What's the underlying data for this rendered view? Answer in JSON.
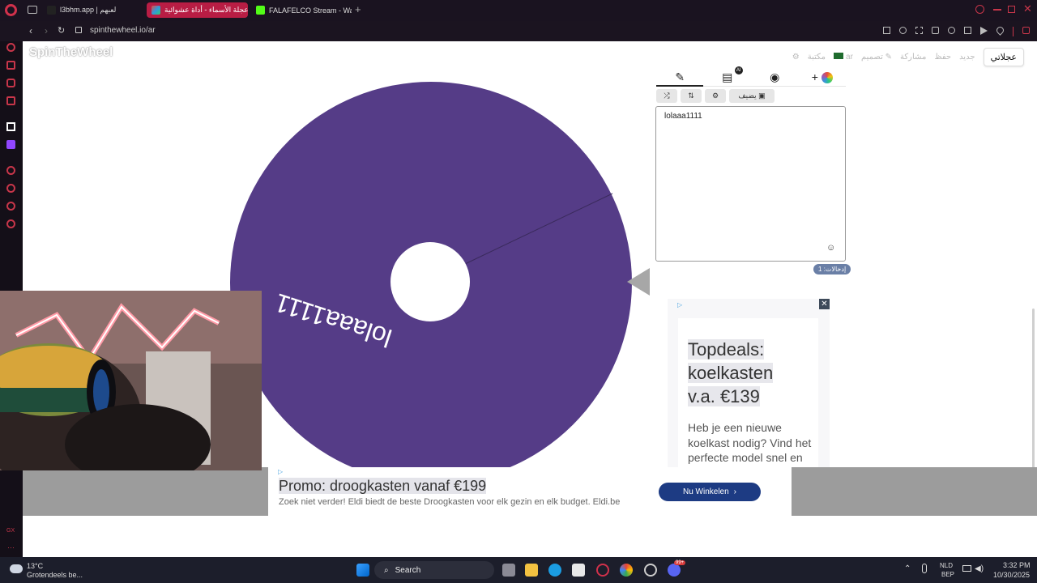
{
  "tabs": [
    {
      "label": "l3bhm.app | لعبهم",
      "active": false
    },
    {
      "label": "برنامج عجلة الأسماء - أداة عشوائية",
      "active": true
    },
    {
      "label": "FALAFELCO Stream - Watch",
      "active": false
    }
  ],
  "address": {
    "url": "spinthewheel.io/ar"
  },
  "site": {
    "logo": "SpinTheWheel"
  },
  "nav": {
    "mine": "عجلاتي",
    "gallery": "مكتبة",
    "lang": "ar",
    "design": "تصميم",
    "share": "مشاركة",
    "save": "حفظ",
    "new": "جديد"
  },
  "editor": {
    "add_label": "يضيف",
    "entries_text": "lolaaa1111",
    "entry_count": "إدخالات: 1",
    "ai_badge": "AI"
  },
  "wheel": {
    "segment_label": "lolaaa1111",
    "segment_color": "#553c87",
    "hub_color": "#ffffff",
    "pointer_color": "#a7a7a7"
  },
  "side_ad": {
    "title_lines": [
      "Topdeals:",
      "koelkasten",
      "v.a. €139"
    ],
    "body": "Heb je een nieuwe koelkast nodig? Vind het perfecte model snel en eenvoudig bij Eldi!",
    "close": "✕"
  },
  "bottom_ad": {
    "title": "Promo: droogkasten vanaf €199",
    "body": "Zoek niet verder! Eldi biedt de beste Droogkasten voor elk gezin en elk budget. Eldi.be",
    "cta": "Nu Winkelen"
  },
  "taskbar": {
    "weather_temp": "13°C",
    "weather_text": "Grotendeels be...",
    "search": "Search",
    "lang_top": "NLD",
    "lang_bottom": "BEP",
    "time": "3:32 PM",
    "date": "10/30/2025",
    "notif_count": "99+"
  }
}
